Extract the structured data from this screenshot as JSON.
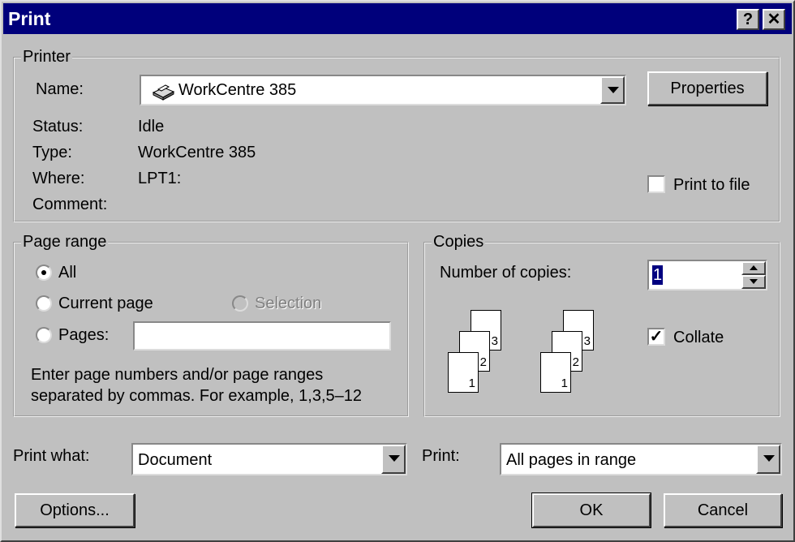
{
  "window": {
    "title": "Print",
    "help_glyph": "?",
    "close_glyph": "✕"
  },
  "printer": {
    "legend": "Printer",
    "name_label": "Name:",
    "name_value": "WorkCentre 385",
    "properties_label": "Properties",
    "status_label": "Status:",
    "status_value": "Idle",
    "type_label": "Type:",
    "type_value": "WorkCentre 385",
    "where_label": "Where:",
    "where_value": "LPT1:",
    "comment_label": "Comment:",
    "print_to_file_label": "Print to file",
    "print_to_file_checked": false
  },
  "page_range": {
    "legend": "Page range",
    "all_label": "All",
    "current_page_label": "Current page",
    "selection_label": "Selection",
    "pages_label": "Pages:",
    "pages_value": "",
    "selected": "all",
    "hint_line1": "Enter page numbers and/or page ranges",
    "hint_line2": "separated by commas.  For example, 1,3,5–12"
  },
  "copies": {
    "legend": "Copies",
    "number_label": "Number of copies:",
    "number_value": "1",
    "collate_label": "Collate",
    "collate_checked": true,
    "check_glyph": "✓",
    "page_numbers": [
      "1",
      "2",
      "3"
    ]
  },
  "print_what": {
    "label": "Print what:",
    "value": "Document"
  },
  "print": {
    "label": "Print:",
    "value": "All pages in range"
  },
  "buttons": {
    "options": "Options...",
    "ok": "OK",
    "cancel": "Cancel"
  }
}
